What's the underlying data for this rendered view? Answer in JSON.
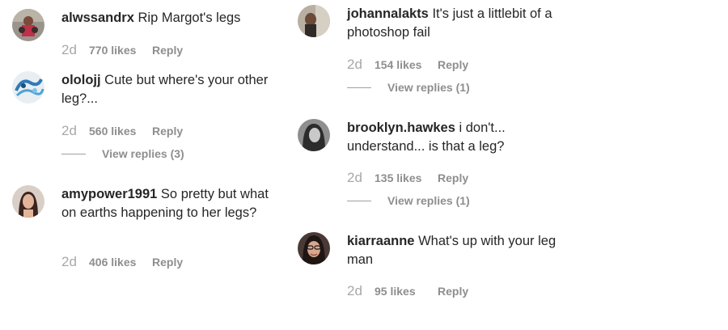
{
  "left_column": {
    "comments": [
      {
        "username": "alwssandrx",
        "text": "Rip Margot's legs",
        "time": "2d",
        "likes": "770 likes",
        "reply": "Reply",
        "view_replies": ""
      },
      {
        "username": "ololojj",
        "text": "Cute but where's your other leg?...",
        "time": "2d",
        "likes": "560 likes",
        "reply": "Reply",
        "view_replies": "View replies (3)"
      },
      {
        "username": "amypower1991",
        "text": "So pretty but what on earths happening to her legs?",
        "time": "2d",
        "likes": "406 likes",
        "reply": "Reply",
        "view_replies": ""
      }
    ]
  },
  "right_column": {
    "comments": [
      {
        "username": "johannalakts",
        "text": "It's just a littlebit of a photoshop fail",
        "time": "2d",
        "likes": "154 likes",
        "reply": "Reply",
        "view_replies": "View replies (1)"
      },
      {
        "username": "brooklyn.hawkes",
        "text": "i don't... understand... is that a leg?",
        "time": "2d",
        "likes": "135 likes",
        "reply": "Reply",
        "view_replies": "View replies (1)"
      },
      {
        "username": "kiarraanne",
        "text": "What's up with your leg man",
        "time": "2d",
        "likes": "95 likes",
        "reply": "Reply",
        "view_replies": ""
      }
    ]
  }
}
